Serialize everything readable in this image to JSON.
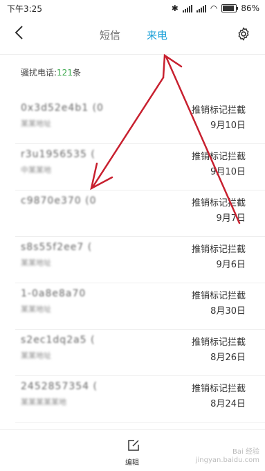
{
  "status": {
    "time": "下午3:25",
    "battery": "86%",
    "battery_level": 0.86
  },
  "nav": {
    "sms_tab": "短信",
    "calls_tab": "来电"
  },
  "summary": {
    "label": "骚扰电话:",
    "count": "121",
    "unit": "条"
  },
  "rows": [
    {
      "number": "0x3d52e4b1 (0",
      "sub": "某某地址",
      "tag": "推销标记拦截",
      "date": "9月10日"
    },
    {
      "number": "r3u1956535 (",
      "sub": "中某某地",
      "tag": "推销标记拦截",
      "date": "9月10日"
    },
    {
      "number": "c9870e370 (0",
      "sub": "",
      "tag": "推销标记拦截",
      "date": "9月7日"
    },
    {
      "number": "s8s55f2ee7 (",
      "sub": "某某地址",
      "tag": "推销标记拦截",
      "date": "9月6日"
    },
    {
      "number": "1-0a8e8a70",
      "sub": "某某地址",
      "tag": "推销标记拦截",
      "date": "8月30日"
    },
    {
      "number": "s2ec1dq2a5 (",
      "sub": "某某地址",
      "tag": "推销标记拦截",
      "date": "8月26日"
    },
    {
      "number": "2452857354 (",
      "sub": "某某某某某地",
      "tag": "推销标记拦截",
      "date": "8月24日"
    }
  ],
  "bottom": {
    "edit_label": "编辑"
  },
  "watermark": {
    "brand": "Bai 经验",
    "url": "jingyan.baidu.com"
  },
  "colors": {
    "accent": "#1ba0d8",
    "count": "#3aa84b",
    "arrow": "#c8202f"
  }
}
